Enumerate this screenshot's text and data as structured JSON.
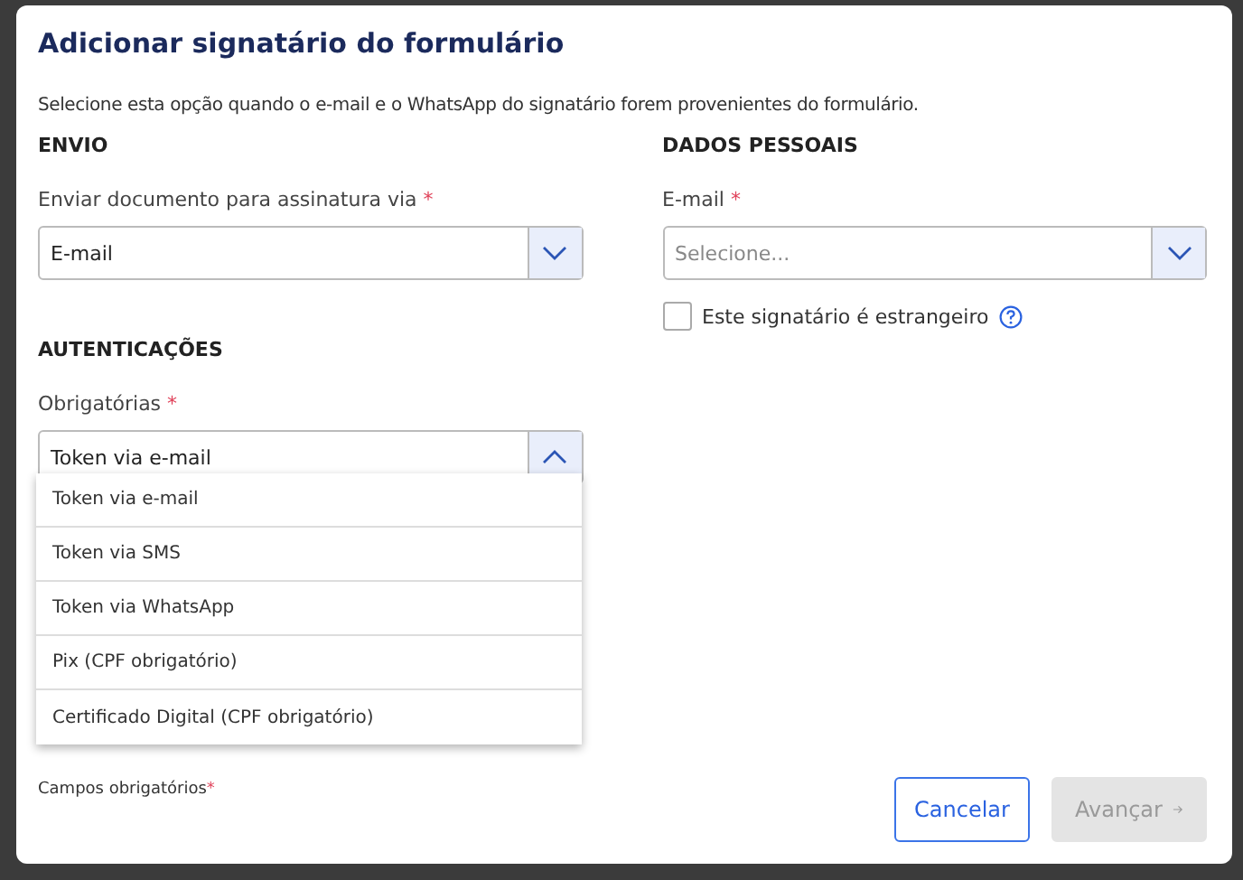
{
  "dialog": {
    "title": "Adicionar signatário do formulário",
    "description": "Selecione esta opção quando o e-mail e o WhatsApp do signatário forem provenientes do formulário."
  },
  "left": {
    "sections": [
      {
        "heading": "ENVIO",
        "field": {
          "label": "Enviar documento para assinatura via",
          "required": true,
          "value": "E-mail",
          "expanded": false
        }
      },
      {
        "heading": "AUTENTICAÇÕES",
        "field": {
          "label": "Obrigatórias",
          "required": true,
          "value": "Token via e-mail",
          "expanded": true,
          "options": [
            {
              "label": "Token via e-mail"
            },
            {
              "label": "Token via SMS"
            },
            {
              "label": "Token via WhatsApp"
            },
            {
              "label": "Pix (CPF obrigatório)"
            },
            {
              "label": "Certificado Digital (CPF obrigatório)"
            }
          ]
        }
      }
    ]
  },
  "right": {
    "heading": "DADOS PESSOAIS",
    "field": {
      "label": "E-mail",
      "required": true,
      "placeholder": "Selecione...",
      "expanded": false
    },
    "checkbox": {
      "label": "Este signatário é estrangeiro",
      "checked": false
    }
  },
  "footer": {
    "note": "Campos obrigatórios",
    "note_mark": "*",
    "buttons": [
      {
        "label": "Cancelar",
        "kind": "secondary",
        "disabled": false
      },
      {
        "label": "Avançar",
        "kind": "primary",
        "disabled": true
      }
    ]
  }
}
